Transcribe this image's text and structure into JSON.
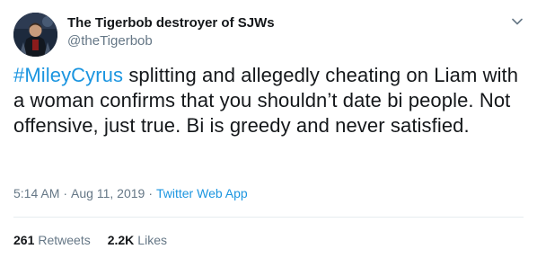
{
  "author": {
    "display_name": "The Tigerbob destroyer of SJWs",
    "handle": "@theTigerbob",
    "avatar_icon": "profile-avatar"
  },
  "menu": {
    "caret_icon": "chevron-down-icon"
  },
  "tweet": {
    "hashtag": "#MileyCyrus",
    "text": " splitting and allegedly cheating on Liam with a woman confirms that you shouldn’t date bi people. Not offensive, just true. Bi is greedy and never satisfied."
  },
  "meta": {
    "time": "5:14 AM",
    "separator1": "·",
    "date": "Aug 11, 2019",
    "separator2": "·",
    "source": "Twitter Web App"
  },
  "stats": {
    "retweets_count": "261",
    "retweets_label": "Retweets",
    "likes_count": "2.2K",
    "likes_label": "Likes"
  },
  "colors": {
    "link": "#1b95e0",
    "secondary_text": "#657786",
    "primary_text": "#14171a",
    "divider": "#e6ecf0"
  }
}
